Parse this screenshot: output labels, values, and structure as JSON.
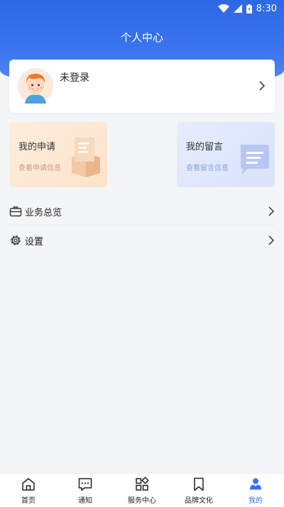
{
  "status_bar": {
    "time": "8:30"
  },
  "header": {
    "title": "个人中心"
  },
  "profile": {
    "login_status": "未登录"
  },
  "quick_cards": [
    {
      "title": "我的申请",
      "subtitle": "查看申请信息"
    },
    {
      "title": "我的留言",
      "subtitle": "查看留言信息"
    }
  ],
  "menu": [
    {
      "label": "业务总览",
      "icon": "briefcase-icon"
    },
    {
      "label": "设置",
      "icon": "gear-icon"
    }
  ],
  "tabbar": {
    "items": [
      {
        "label": "首页",
        "icon": "home-icon"
      },
      {
        "label": "通知",
        "icon": "message-icon"
      },
      {
        "label": "服务中心",
        "icon": "grid-icon"
      },
      {
        "label": "品牌文化",
        "icon": "bookmark-icon"
      },
      {
        "label": "我的",
        "icon": "user-icon"
      }
    ],
    "active_index": 4
  },
  "colors": {
    "brand": "#3b75ef",
    "active_tab": "#3a6ff0",
    "background": "#f4f5f7"
  }
}
